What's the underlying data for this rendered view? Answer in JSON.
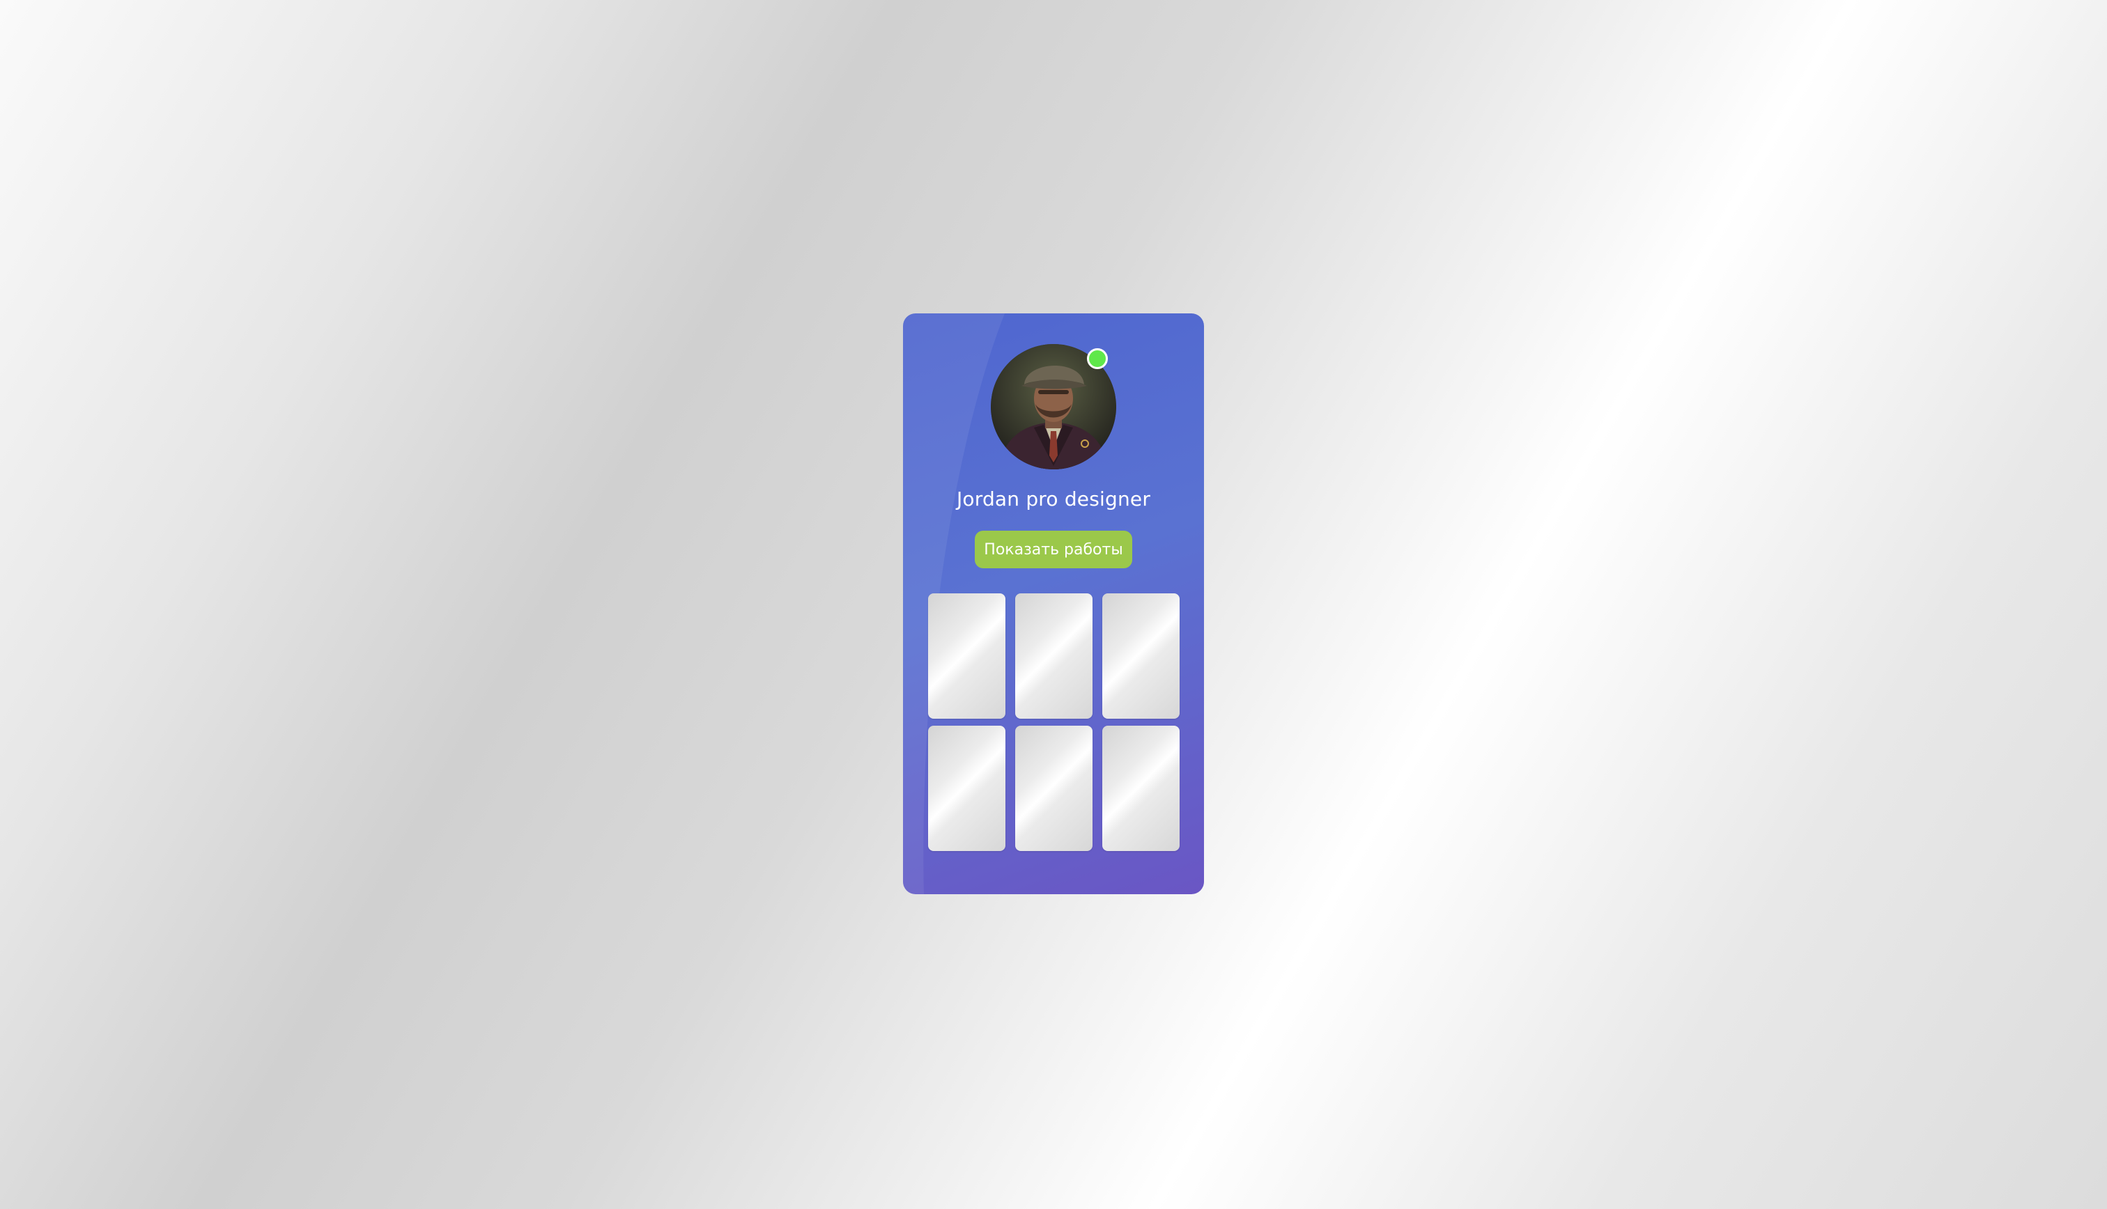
{
  "profile": {
    "name": "Jordan pro designer",
    "online": true,
    "show_works_label": "Показать работы"
  },
  "works": [
    {
      "title": ""
    },
    {
      "title": ""
    },
    {
      "title": ""
    },
    {
      "title": ""
    },
    {
      "title": ""
    },
    {
      "title": ""
    }
  ],
  "colors": {
    "card_start": "#4f66cf",
    "card_end": "#6a56c4",
    "button": "#9bc84a",
    "status_online": "#5fe84a"
  }
}
